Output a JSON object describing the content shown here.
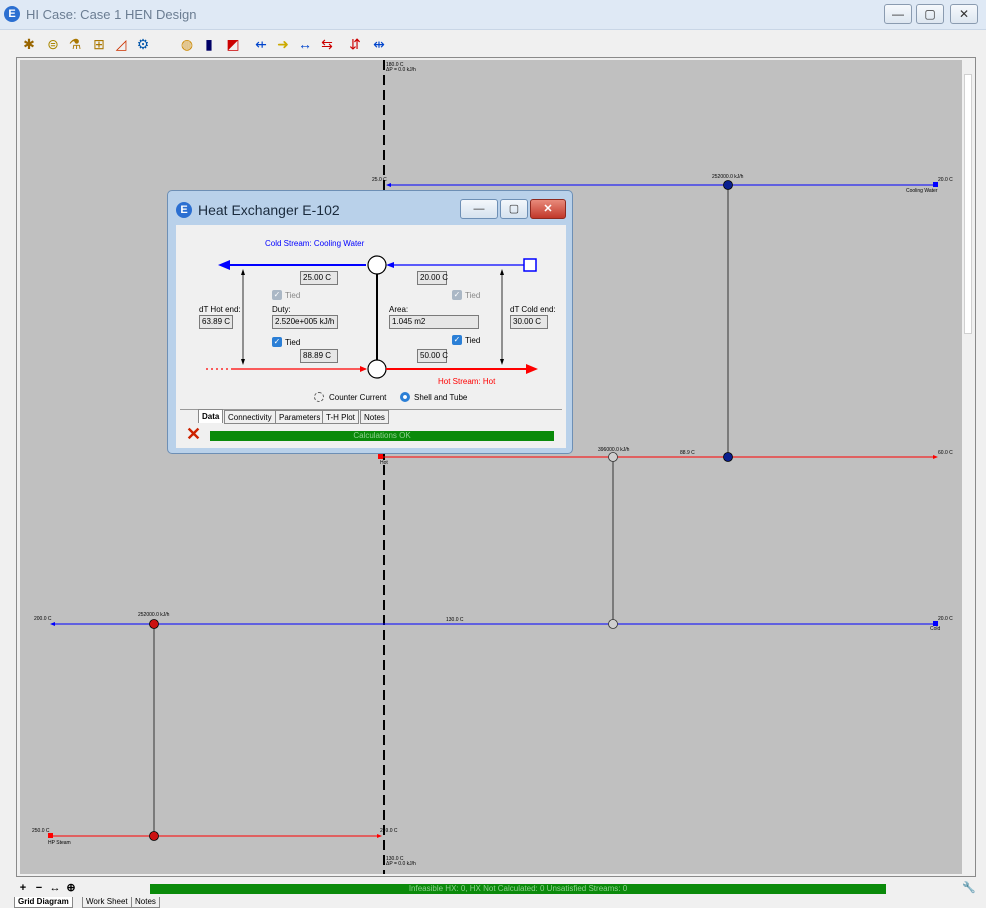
{
  "window": {
    "title": "HI Case: Case 1 HEN Design",
    "app_letter": "E",
    "minimize": "—",
    "maximize": "▢",
    "close": "✕"
  },
  "toolbar": {
    "icons": [
      "grid-tool-icon",
      "exchanger-tool-icon",
      "match-tool-icon",
      "split-tool-icon",
      "mixer-tool-icon",
      "target-tool-icon",
      "stream-tool-icon",
      "composite-tool-icon",
      "chart-tool-icon",
      "th-plot-tool-icon",
      "add-stream-icon",
      "delete-stream-icon",
      "cut-icon",
      "connect-icon",
      "disconnect-icon"
    ]
  },
  "grid": {
    "streams": [
      {
        "name": "Cooling Water",
        "inlet_temp": "20.0 C",
        "outlet_temp": "25.0 C",
        "color": "#0000ff"
      },
      {
        "name": "Hot",
        "inlet_temp": "60.0 C",
        "mid_temp": "88.9 C",
        "color": "#ff0000"
      },
      {
        "name": "Cold",
        "inlet_temp": "20.0 C",
        "outlet_temp": "200.0 C",
        "mid_temp": "130.0 C",
        "color": "#0000ff"
      },
      {
        "name": "HP Steam",
        "inlet_temp": "250.0 C",
        "outlet_temp": "249.0 C",
        "color": "#ff0000"
      }
    ],
    "top_pinch_label": "180.0 C\nΔP = 0.0 kJ/h",
    "bottom_pinch_label": "130.0 C\nΔP = 0.0 kJ/h",
    "duties": [
      "252000.0 kJ/h",
      "396000.0 kJ/h",
      "252000.0 kJ/h"
    ],
    "hot_stream_label": "Hot"
  },
  "dialog": {
    "title": "Heat Exchanger E-102",
    "app_letter": "E",
    "cold_stream_label": "Cold Stream: Cooling Water",
    "hot_stream_label": "Hot Stream: Hot",
    "cold_out": "25.00 C",
    "cold_in": "20.00 C",
    "hot_in": "88.89 C",
    "hot_out": "50.00 C",
    "tied_label": "Tied",
    "dt_hot_label": "dT Hot end:",
    "dt_hot_value": "63.89 C",
    "duty_label": "Duty:",
    "duty_value": "2.520e+005 kJ/h",
    "area_label": "Area:",
    "area_value": "1.045 m2",
    "dt_cold_label": "dT Cold end:",
    "dt_cold_value": "30.00 C",
    "counter_current_label": "Counter Current",
    "shell_tube_label": "Shell and Tube",
    "tabs": [
      "Data",
      "Connectivity",
      "Parameters",
      "T-H Plot",
      "Notes"
    ],
    "status": "Calculations OK"
  },
  "status": {
    "text": "Infeasible HX: 0, HX Not Calculated: 0    Unsatisfied Streams: 0"
  },
  "zoom": {
    "in": "+",
    "out": "−",
    "fit": "↔",
    "all": "⊕"
  },
  "bottom_tabs": [
    "Grid Diagram",
    "Work Sheet",
    "Notes"
  ],
  "colors": {
    "hot": "#ff0000",
    "cold": "#0000ff",
    "ok": "#0a8a0a"
  }
}
